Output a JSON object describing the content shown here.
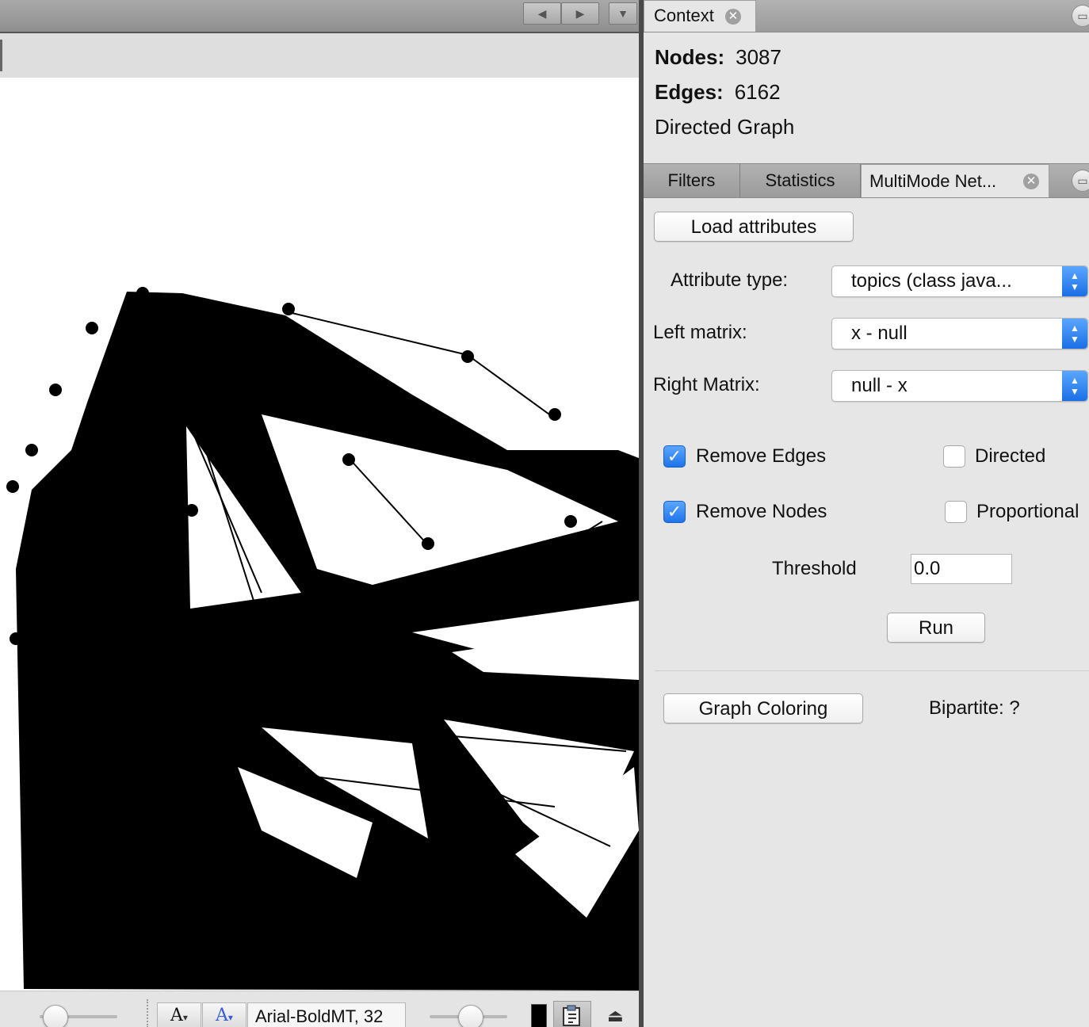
{
  "context_panel": {
    "tab_label": "Context",
    "nodes_label": "Nodes:",
    "nodes_value": "3087",
    "edges_label": "Edges:",
    "edges_value": "6162",
    "graph_type": "Directed Graph"
  },
  "tools_tabs": [
    {
      "label": "Filters",
      "active": false
    },
    {
      "label": "Statistics",
      "active": false
    },
    {
      "label": "MultiMode Net...",
      "active": true
    }
  ],
  "multimode": {
    "load_attributes_label": "Load attributes",
    "attribute_type_label": "Attribute type:",
    "attribute_type_value": "topics (class java...",
    "left_matrix_label": "Left matrix:",
    "left_matrix_value": "x - null",
    "right_matrix_label": "Right Matrix:",
    "right_matrix_value": "null - x",
    "remove_edges_label": "Remove Edges",
    "remove_edges_checked": true,
    "directed_label": "Directed",
    "directed_checked": false,
    "remove_nodes_label": "Remove Nodes",
    "remove_nodes_checked": true,
    "proportional_label": "Proportional",
    "proportional_checked": false,
    "threshold_label": "Threshold",
    "threshold_value": "0.0",
    "run_label": "Run",
    "graph_coloring_label": "Graph Coloring",
    "bipartite_label": "Bipartite: ?"
  },
  "graph_bottombar": {
    "font_field": "Arial-BoldMT, 32",
    "node_label_button": "A",
    "edge_label_button": "A",
    "node_label_color": "#000000",
    "edge_label_color": "#3a5bd6"
  },
  "colors": {
    "accent_blue": "#1f74ea",
    "graph_ink": "#000000",
    "panel_bg": "#e6e6e6"
  }
}
